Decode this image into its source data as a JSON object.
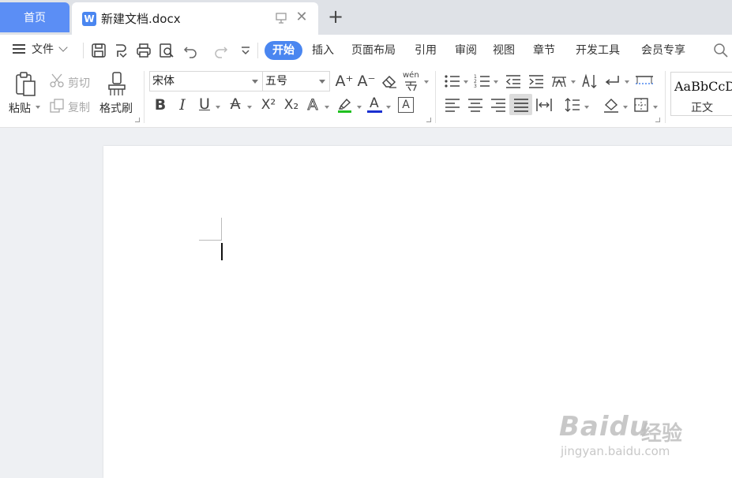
{
  "tabs": {
    "home_label": "首页",
    "doc_icon_letter": "W",
    "doc_title": "新建文档.docx",
    "close_glyph": "✕",
    "new_tab_glyph": "+"
  },
  "menu": {
    "file_label": "文件",
    "tabs": [
      "开始",
      "插入",
      "页面布局",
      "引用",
      "审阅",
      "视图",
      "章节",
      "开发工具",
      "会员专享"
    ],
    "active_tab": "开始"
  },
  "ribbon": {
    "paste_label": "粘贴",
    "cut_label": "剪切",
    "copy_label": "复制",
    "format_painter_label": "格式刷",
    "font_name": "宋体",
    "font_size": "五号",
    "bold": "B",
    "italic": "I",
    "underline": "U",
    "strike": "A",
    "superscript": "X²",
    "subscript": "X₂",
    "text_effect": "A",
    "font_color": "A",
    "char_border": "A",
    "grow": "A⁺",
    "shrink": "A⁻",
    "pinyin": "wén",
    "style_sample": "AaBbCcDd",
    "style_name": "正文"
  },
  "colors": {
    "accent": "#4a86f0",
    "home_tab": "#5b8ef5",
    "highlight_bar": "#20c020",
    "font_color_bar": "#1a2fd0"
  },
  "watermark": {
    "brand": "Bai",
    "brand_mid": "du",
    "brand_cn": "经验",
    "url": "jingyan.baidu.com"
  }
}
